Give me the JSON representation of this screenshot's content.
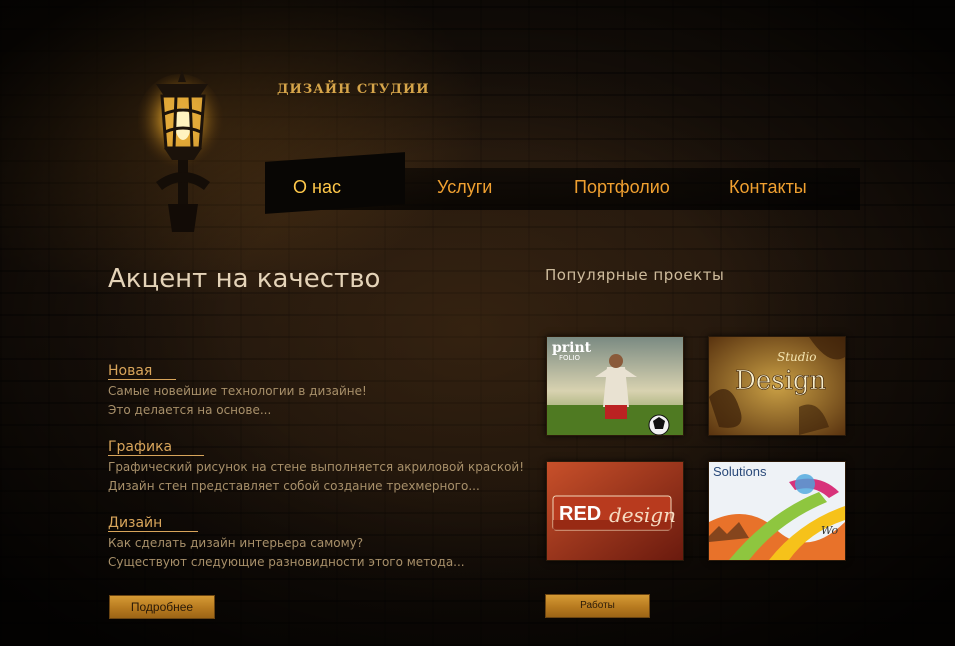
{
  "header": {
    "site_title": "ДИЗАЙН СТУДИИ"
  },
  "nav": {
    "items": [
      {
        "label": "О нас",
        "active": true
      },
      {
        "label": "Услуги",
        "active": false
      },
      {
        "label": "Портфолио",
        "active": false
      },
      {
        "label": "Контакты",
        "active": false
      }
    ]
  },
  "main": {
    "headline": "Акцент на качество",
    "sections": [
      {
        "title": "Новая",
        "lines": [
          "Самые новейшие технологии в дизайне!",
          "Это делается на основе..."
        ]
      },
      {
        "title": "Графика",
        "lines": [
          "Графический рисунок на стене   выполняется акриловой краской!",
          "Дизайн стен представляет собой создание трехмерного..."
        ]
      },
      {
        "title": "Дизайн",
        "lines": [
          "Как сделать дизайн интерьера самому?",
          "Существуют следующие разновидности этого метода..."
        ]
      }
    ],
    "more_button": "Подробнее"
  },
  "popular": {
    "title": "Популярные проекты",
    "thumbs": [
      {
        "name": "print-folio-thumb",
        "text_main": "print",
        "text_sub": "FOLIO"
      },
      {
        "name": "studio-design-thumb",
        "text_main": "Design",
        "text_sub": "Studio"
      },
      {
        "name": "red-design-thumb",
        "text_main": "RED",
        "text_sub": "design"
      },
      {
        "name": "solutions-thumb",
        "text_main": "Solutions",
        "text_sub": "Wo"
      }
    ],
    "works_button": "Работы"
  },
  "colors": {
    "accent": "#f0a030",
    "link": "#d8a55b",
    "body_text": "#a8906a"
  }
}
